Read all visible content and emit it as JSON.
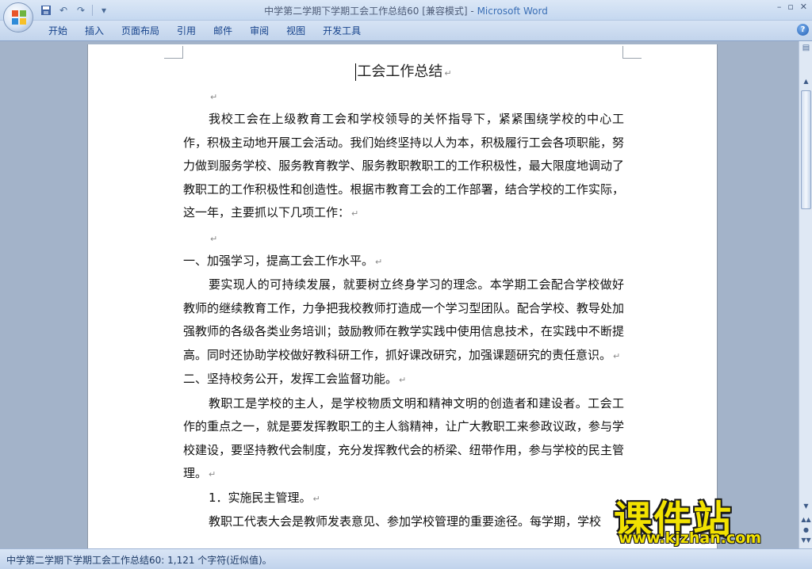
{
  "window": {
    "title_doc": "中学第二学期下学期工会工作总结60 [兼容模式]",
    "title_sep": " - ",
    "title_app": "Microsoft Word"
  },
  "ribbon": {
    "tabs": [
      "开始",
      "插入",
      "页面布局",
      "引用",
      "邮件",
      "审阅",
      "视图",
      "开发工具"
    ],
    "help_label": "?"
  },
  "document": {
    "title": "工会工作总结",
    "paragraph_mark": "↵",
    "blocks": [
      {
        "type": "empty"
      },
      {
        "type": "para",
        "text": "我校工会在上级教育工会和学校领导的关怀指导下，紧紧围绕学校的中心工作，积极主动地开展工会活动。我们始终坚持以人为本，积极履行工会各项职能，努力做到服务学校、服务教育教学、服务教职教职工的工作积极性，最大限度地调动了教职工的工作积极性和创造性。根据市教育工会的工作部署，结合学校的工作实际，这一年，主要抓以下几项工作："
      },
      {
        "type": "empty"
      },
      {
        "type": "heading",
        "text": "一、加强学习，提高工会工作水平。"
      },
      {
        "type": "para",
        "text": "要实现人的可持续发展，就要树立终身学习的理念。本学期工会配合学校做好教师的继续教育工作，力争把我校教师打造成一个学习型团队。配合学校、教导处加强教师的各级各类业务培训；鼓励教师在教学实践中使用信息技术，在实践中不断提高。同时还协助学校做好教科研工作，抓好课改研究，加强课题研究的责任意识。"
      },
      {
        "type": "heading",
        "text": "二、坚持校务公开，发挥工会监督功能。"
      },
      {
        "type": "para",
        "text": "教职工是学校的主人，是学校物质文明和精神文明的创造者和建设者。工会工作的重点之一，就是要发挥教职工的主人翁精神，让广大教职工来参政议政，参与学校建设，要坚持教代会制度，充分发挥教代会的桥梁、纽带作用，参与学校的民主管理。"
      },
      {
        "type": "sub",
        "text": "1．实施民主管理。"
      },
      {
        "type": "para",
        "text": "教职工代表大会是教师发表意见、参加学校管理的重要途径。每学期，学校"
      }
    ]
  },
  "status": {
    "text": "中学第二学期下学期工会工作总结60: 1,121 个字符(近似值)。"
  },
  "watermark": {
    "big": "课件站",
    "url": "www.kjzhan.com"
  },
  "colors": {
    "ribbon_bg": "#c5d8f0",
    "tab_text": "#15428b",
    "app_title": "#3b6fb6",
    "workspace": "#a3b3c9",
    "watermark_yellow": "#f2e200"
  },
  "icons": [
    "office-button-icon",
    "save-icon",
    "undo-icon",
    "redo-icon",
    "customize-qat-icon",
    "minimize-icon",
    "restore-icon",
    "close-icon",
    "help-icon",
    "ruler-toggle-icon",
    "scroll-up-icon",
    "scroll-down-icon",
    "previous-page-icon",
    "browse-object-icon",
    "next-page-icon"
  ]
}
